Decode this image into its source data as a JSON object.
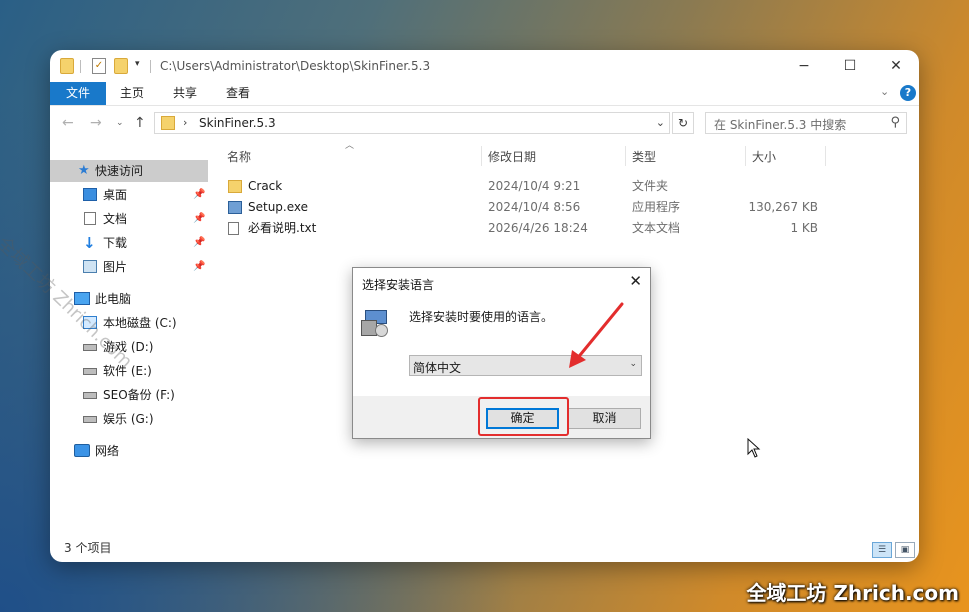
{
  "window": {
    "title_path": "C:\\Users\\Administrator\\Desktop\\SkinFiner.5.3",
    "controls": [
      "−",
      "☐",
      "✕"
    ]
  },
  "ribbon": {
    "tabs": [
      "文件",
      "主页",
      "共享",
      "查看"
    ],
    "help": "?"
  },
  "navigation": {
    "address": "SkinFiner.5.3",
    "search_placeholder": "在 SkinFiner.5.3 中搜索"
  },
  "sidebar": {
    "quick_access": "快速访问",
    "pinned": [
      {
        "label": "桌面",
        "icon": "desktop-icon"
      },
      {
        "label": "文档",
        "icon": "document-icon"
      },
      {
        "label": "下载",
        "icon": "download-icon"
      },
      {
        "label": "图片",
        "icon": "pictures-icon"
      }
    ],
    "this_pc": "此电脑",
    "drives": [
      {
        "label": "本地磁盘 (C:)"
      },
      {
        "label": "游戏 (D:)"
      },
      {
        "label": "软件 (E:)"
      },
      {
        "label": "SEO备份 (F:)"
      },
      {
        "label": "娱乐 (G:)"
      }
    ],
    "network": "网络"
  },
  "file_list": {
    "headers": {
      "name": "名称",
      "date": "修改日期",
      "type": "类型",
      "size": "大小"
    },
    "rows": [
      {
        "name": "Crack",
        "date": "2024/10/4 9:21",
        "type": "文件夹",
        "size": "",
        "icon": "folder"
      },
      {
        "name": "Setup.exe",
        "date": "2024/10/4 8:56",
        "type": "应用程序",
        "size": "130,267 KB",
        "icon": "exe"
      },
      {
        "name": "必看说明.txt",
        "date": "2026/4/26 18:24",
        "type": "文本文档",
        "size": "1 KB",
        "icon": "txt"
      }
    ]
  },
  "status": {
    "item_count": "3 个项目"
  },
  "dialog": {
    "title": "选择安装语言",
    "message": "选择安装时要使用的语言。",
    "selected_language": "简体中文",
    "ok_label": "确定",
    "cancel_label": "取消"
  },
  "watermark": {
    "corner": "全域工坊 Zhrich.com",
    "diagonal": "全域工坊 Zhrich.com"
  }
}
